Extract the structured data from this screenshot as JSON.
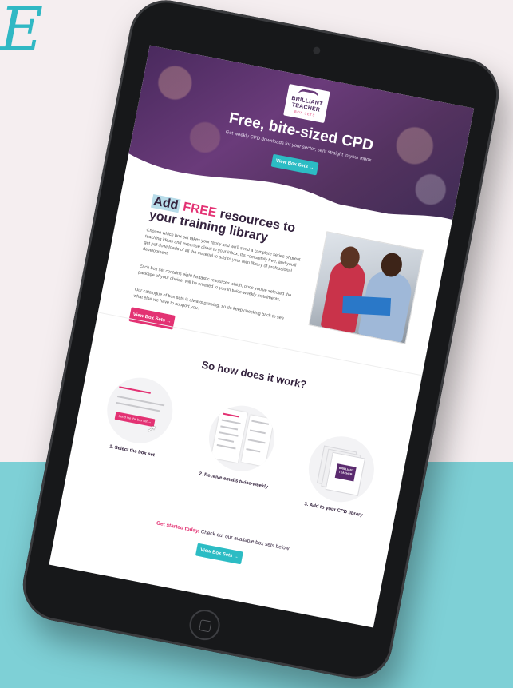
{
  "brand_letter": "E",
  "hero": {
    "logo_lines": [
      "BRILLIANT",
      "TEACHER"
    ],
    "logo_sub": "BOX SETS",
    "title": "Free, bite-sized CPD",
    "subtitle": "Get weekly CPD downloads for your sector, sent straight to your inbox",
    "button_label": "View Box Sets →"
  },
  "resources": {
    "heading_add": "Add",
    "heading_free": "FREE",
    "heading_rest": "resources to your training library",
    "para1": "Choose which box set takes your fancy and we'll send a complete series of great teaching ideas and expertise direct to your inbox. It's completely free, and you'll get pdf downloads of all the material to add to your own library of professional development.",
    "para2": "Each box set contains eight fantastic resources which, once you've selected the package of your choice, will be emailed to you in twice-weekly instalments.",
    "para3": "Our catalogue of box sets is always growing, so do keep checking back to see what else we have to support you.",
    "button_label": "View Box Sets →"
  },
  "how": {
    "title": "So how does it work?",
    "steps": [
      {
        "label": "1. Select the box set",
        "mini_button": "Send me the box set →"
      },
      {
        "label": "2. Receive emails twice-weekly"
      },
      {
        "label": "3. Add to your CPD library",
        "badge_lines": [
          "BRILLIANT",
          "TEACHER"
        ]
      }
    ]
  },
  "cta": {
    "highlight": "Get started today.",
    "rest": "Check out our available box sets below",
    "button_label": "View Box Sets →"
  },
  "colors": {
    "purple": "#4a2a5e",
    "pink": "#e33273",
    "teal": "#2cbcc4",
    "bg_teal": "#7ed0d6"
  }
}
